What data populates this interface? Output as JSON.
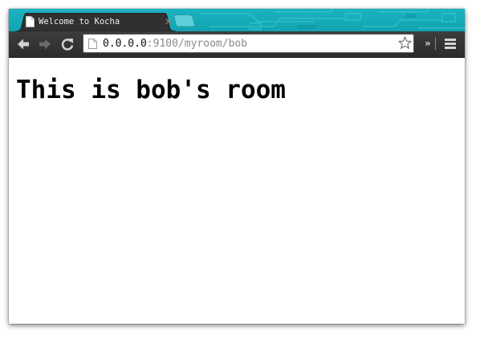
{
  "browser": {
    "tab": {
      "title": "Welcome to Kocha",
      "close_glyph": "✕",
      "favicon": "page-icon"
    },
    "new_tab": {
      "icon": "new-tab-icon"
    },
    "toolbar": {
      "back_icon": "back-arrow-icon",
      "forward_icon": "forward-arrow-icon",
      "reload_icon": "reload-icon",
      "extensions_glyph": "»",
      "menu_icon": "hamburger-menu-icon"
    },
    "address_bar": {
      "host": "0.0.0.0",
      "path": ":9100/myroom/bob",
      "bookmark_icon": "star-icon"
    }
  },
  "page": {
    "heading": "This is bob's room"
  },
  "colors": {
    "tab_strip": "#11a3b2",
    "toolbar": "#2f2f2f",
    "url_host": "#111111",
    "url_path": "#8a8a8a"
  }
}
